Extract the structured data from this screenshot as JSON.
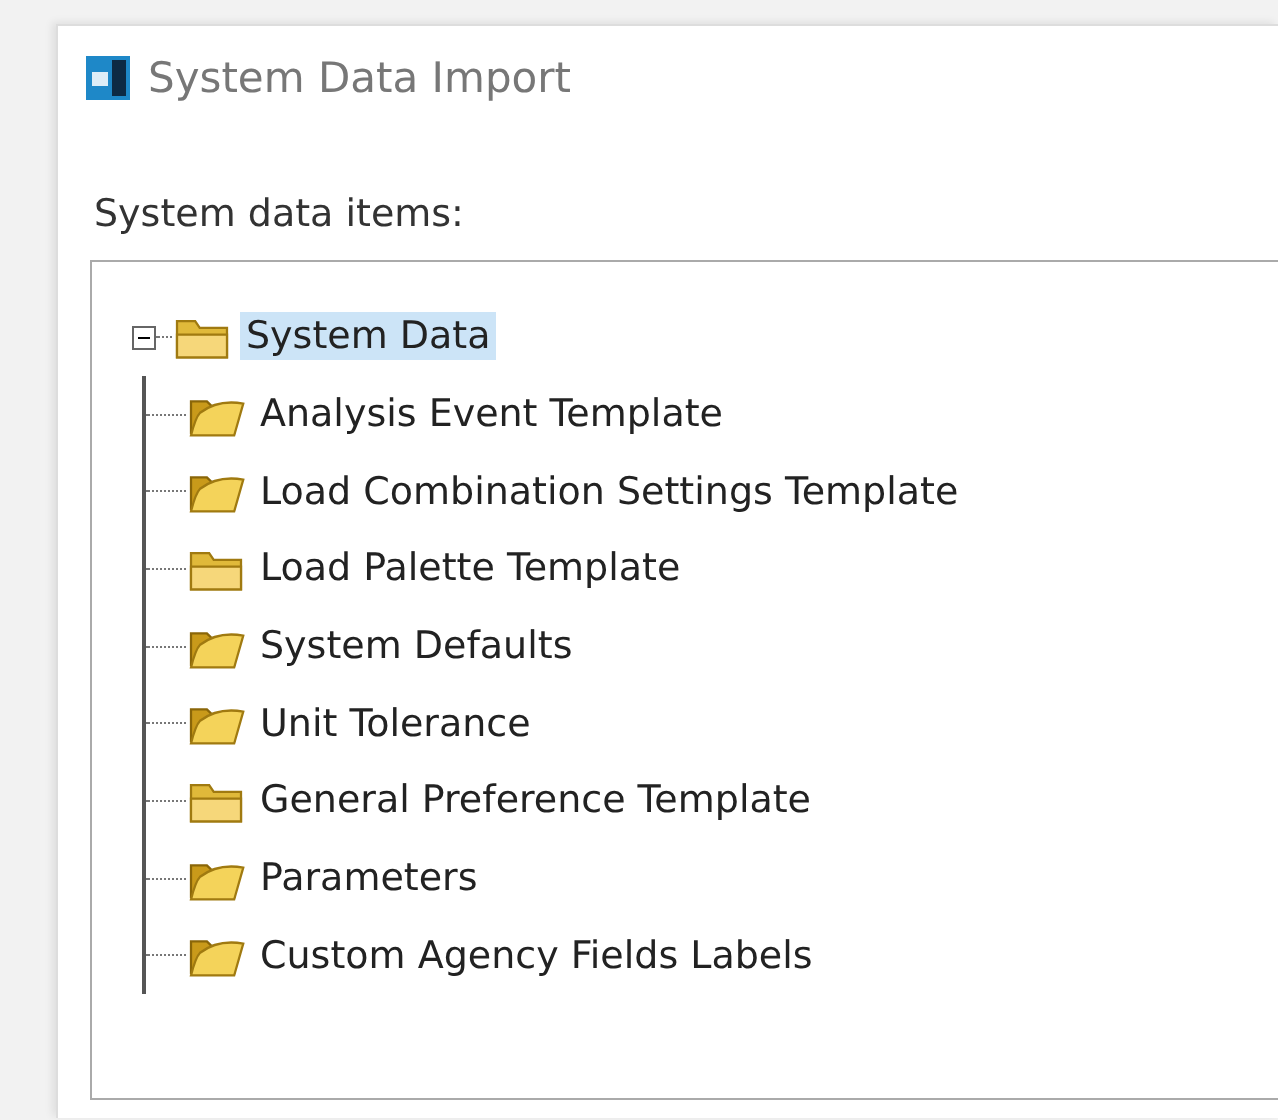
{
  "window": {
    "title": "System Data Import"
  },
  "label": "System data items:",
  "tree": [
    {
      "label": "System Data",
      "kind": "closed",
      "selected": true,
      "expanded": true,
      "children": [
        {
          "label": "Analysis Event Template",
          "kind": "open",
          "selected": false
        },
        {
          "label": "Load Combination Settings Template",
          "kind": "open",
          "selected": false
        },
        {
          "label": "Load Palette Template",
          "kind": "closed",
          "selected": false
        },
        {
          "label": "System Defaults",
          "kind": "open",
          "selected": false
        },
        {
          "label": "Unit Tolerance",
          "kind": "open",
          "selected": false
        },
        {
          "label": "General Preference Template",
          "kind": "closed",
          "selected": false
        },
        {
          "label": "Parameters",
          "kind": "open",
          "selected": false
        },
        {
          "label": "Custom Agency Fields Labels",
          "kind": "open",
          "selected": false
        }
      ]
    }
  ]
}
